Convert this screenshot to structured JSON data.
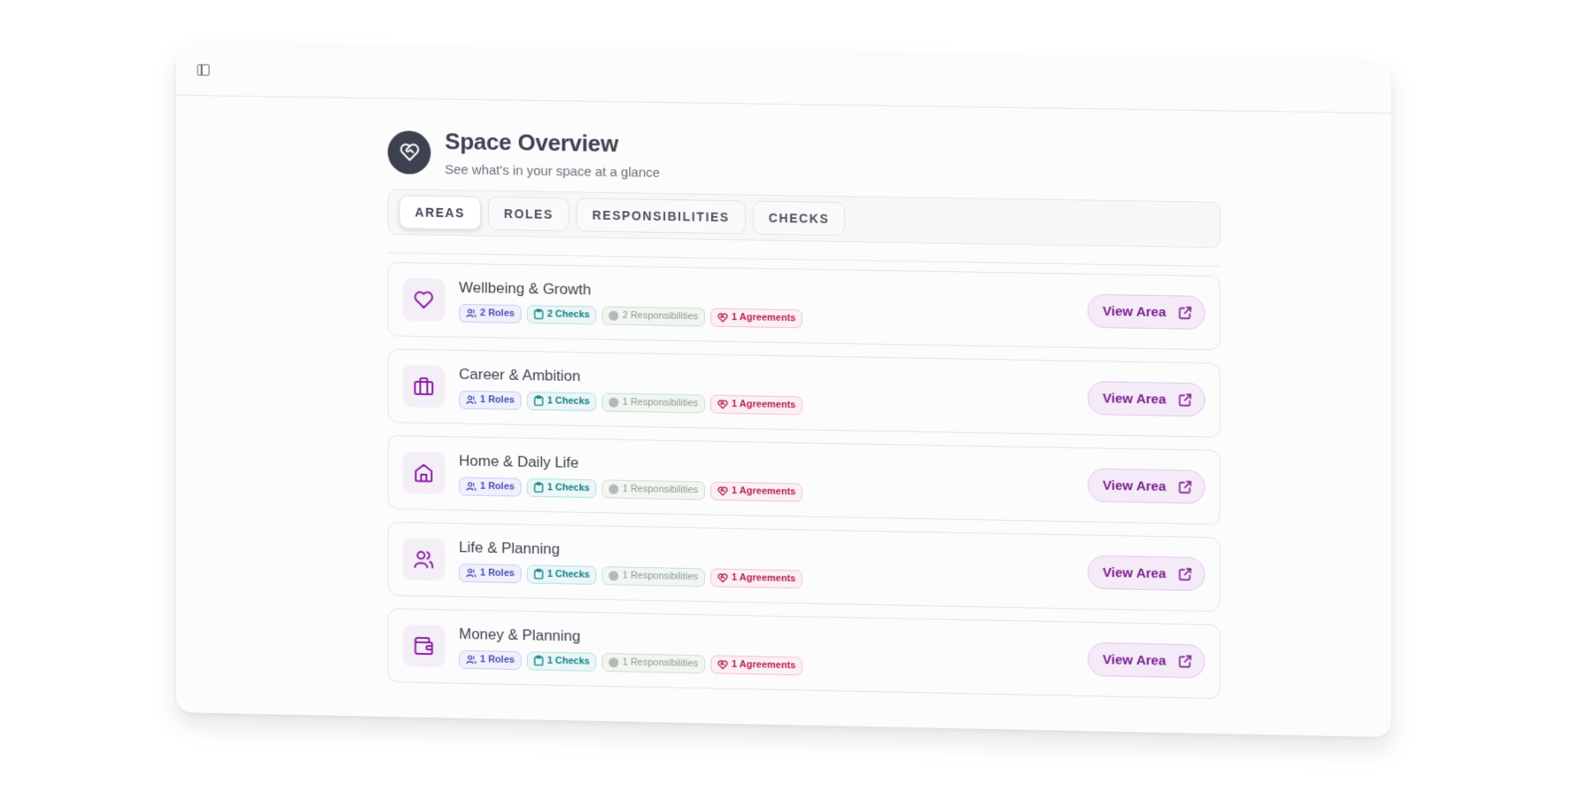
{
  "header": {
    "title": "Space Overview",
    "subtitle": "See what's in your space at a glance"
  },
  "tabs": [
    {
      "label": "AREAS",
      "active": true
    },
    {
      "label": "ROLES",
      "active": false
    },
    {
      "label": "RESPONSIBILITIES",
      "active": false
    },
    {
      "label": "CHECKS",
      "active": false
    }
  ],
  "areas": [
    {
      "title": "Wellbeing & Growth",
      "icon": "heart-icon",
      "roles": "2 Roles",
      "checks": "2 Checks",
      "responsibilities": "2 Responsibilities",
      "agreements": "1 Agreements",
      "button": "View Area"
    },
    {
      "title": "Career & Ambition",
      "icon": "briefcase-icon",
      "roles": "1 Roles",
      "checks": "1 Checks",
      "responsibilities": "1 Responsibilities",
      "agreements": "1 Agreements",
      "button": "View Area"
    },
    {
      "title": "Home & Daily Life",
      "icon": "home-icon",
      "roles": "1 Roles",
      "checks": "1 Checks",
      "responsibilities": "1 Responsibilities",
      "agreements": "1 Agreements",
      "button": "View Area"
    },
    {
      "title": "Life & Planning",
      "icon": "users-icon",
      "roles": "1 Roles",
      "checks": "1 Checks",
      "responsibilities": "1 Responsibilities",
      "agreements": "1 Agreements",
      "button": "View Area"
    },
    {
      "title": "Money & Planning",
      "icon": "wallet-icon",
      "roles": "1 Roles",
      "checks": "1 Checks",
      "responsibilities": "1 Responsibilities",
      "agreements": "1 Agreements",
      "button": "View Area"
    }
  ],
  "colors": {
    "accent": "#7a1f8e",
    "header_badge": "#3d4250"
  }
}
